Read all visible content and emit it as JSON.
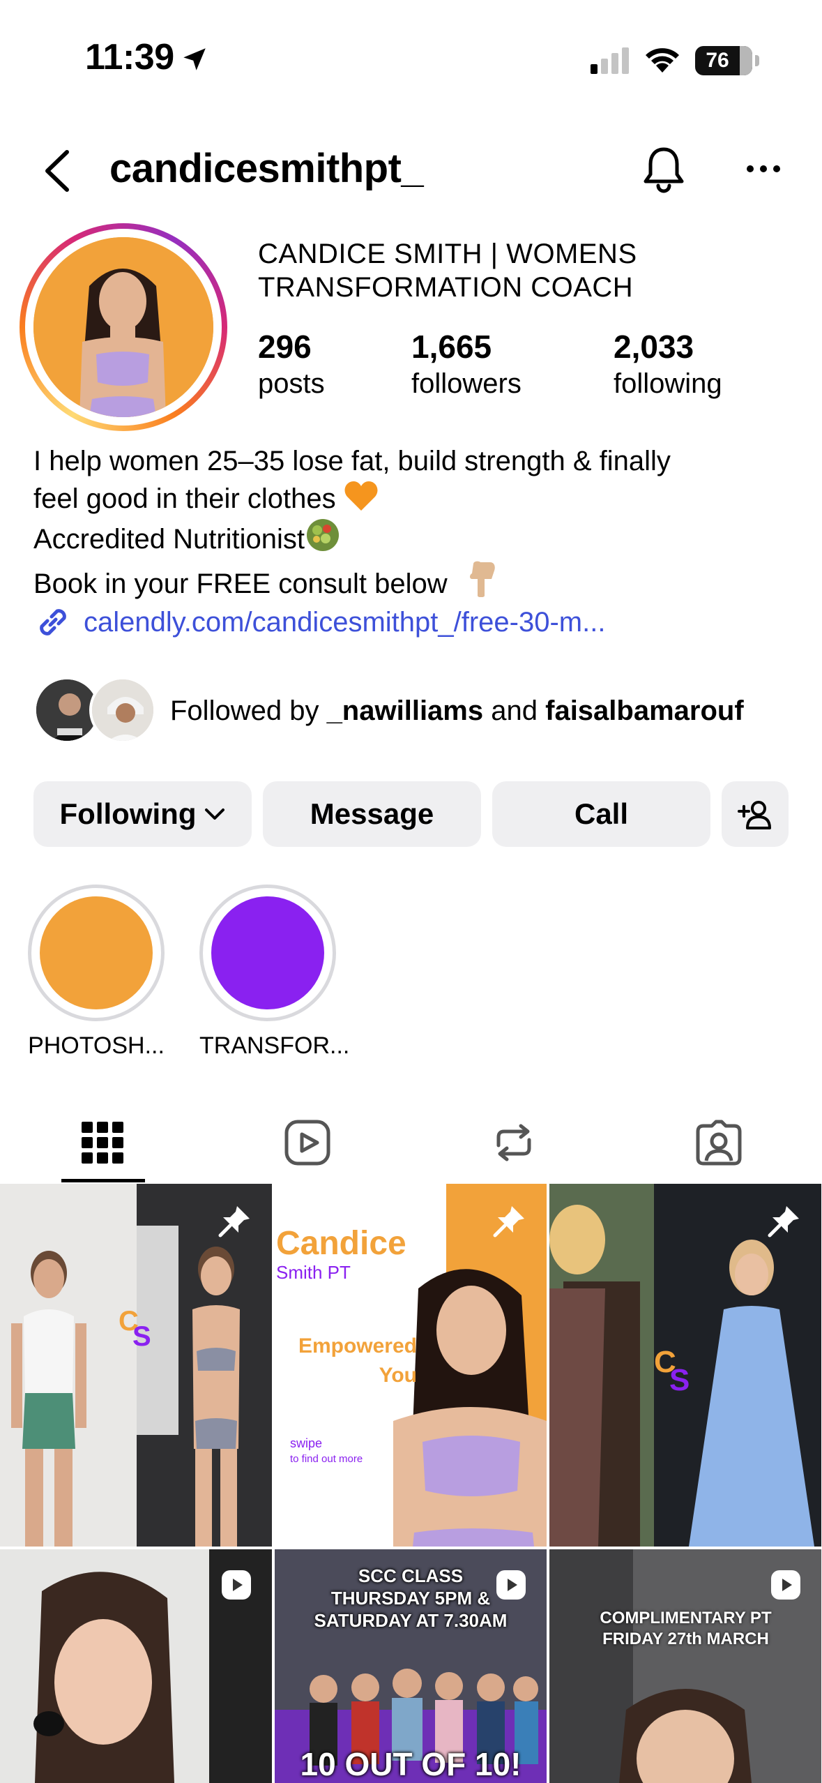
{
  "status": {
    "time": "11:39",
    "battery": "76"
  },
  "header": {
    "username": "candicesmithpt_"
  },
  "profile": {
    "display_name": "CANDICE SMITH | WOMENS TRANSFORMATION COACH",
    "stats": [
      {
        "value": "296",
        "label": "posts"
      },
      {
        "value": "1,665",
        "label": "followers"
      },
      {
        "value": "2,033",
        "label": "following"
      }
    ],
    "bio": [
      "I help women 25–35 lose fat, build strength & finally",
      "feel good in their clothes",
      "Accredited Nutritionist",
      "Book in your FREE consult below"
    ],
    "link": "calendly.com/candicesmithpt_/free-30-m...",
    "followed_by": {
      "prefix": "Followed by",
      "user1": "_nawilliams",
      "joiner": "and",
      "user2": "faisalbamarouf"
    }
  },
  "actions": {
    "following": "Following",
    "message": "Message",
    "call": "Call"
  },
  "highlights": [
    {
      "label": "PHOTOSH...",
      "color": "#f2a23a"
    },
    {
      "label": "TRANSFOR...",
      "color": "#8a21f0"
    }
  ],
  "tabs": [
    "grid-icon",
    "reels-icon",
    "reposts-icon",
    "tagged-icon"
  ],
  "posts": {
    "post2_title": "Candice",
    "post2_sub": "Smith PT",
    "post2_line1": "Empowered",
    "post2_line2": "You",
    "post2_swipe": "swipe",
    "post2_find": "to find out more",
    "post5_line1": "SCC CLASS",
    "post5_line2": "THURSDAY 5PM &",
    "post5_line3": "SATURDAY AT 7.30AM",
    "post5_banner": "10 OUT OF 10!",
    "post6_line1": "COMPLIMENTARY PT",
    "post6_line2": "FRIDAY 27th MARCH"
  },
  "colors": {
    "accent_orange": "#f2a23a",
    "accent_purple": "#8a21f0",
    "link_blue": "#3d50d9",
    "button_bg": "#efeff1"
  }
}
